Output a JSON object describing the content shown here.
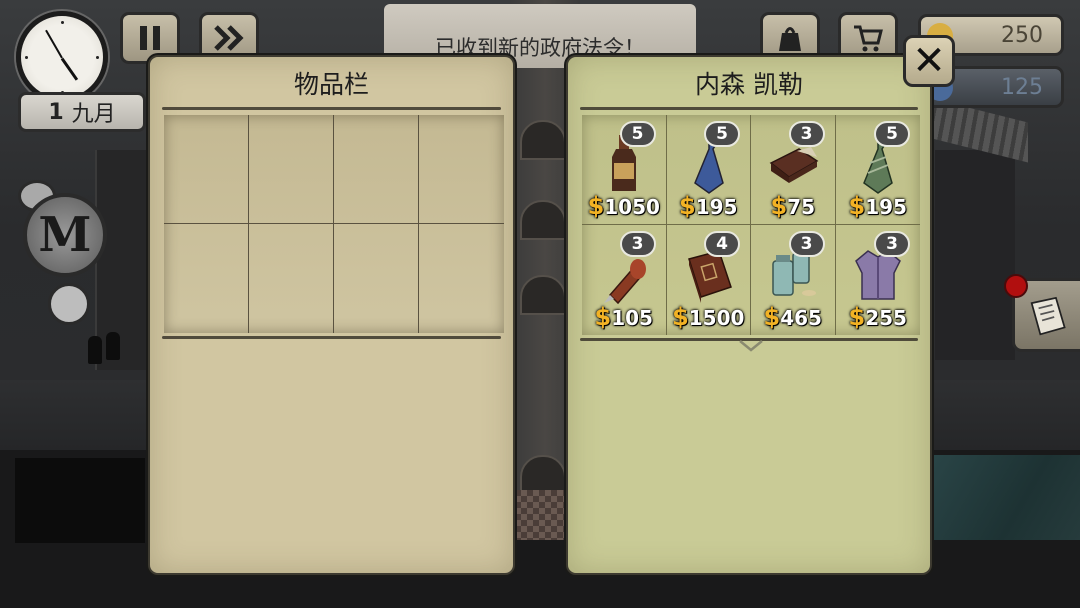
{
  "hud": {
    "date_day": "1",
    "date_month": "九月",
    "money": "250",
    "reputation": "125",
    "notice": "已收到新的政府法令！"
  },
  "inventory": {
    "title": "物品栏"
  },
  "shop": {
    "title": "内森 凯勒",
    "currency_symbol": "$",
    "items": [
      {
        "icon": "bottle-icon",
        "qty": "5",
        "price": "1050"
      },
      {
        "icon": "blue-tie-icon",
        "qty": "5",
        "price": "195"
      },
      {
        "icon": "chocolate-bar-icon",
        "qty": "3",
        "price": "75"
      },
      {
        "icon": "green-tie-icon",
        "qty": "5",
        "price": "195"
      },
      {
        "icon": "fountain-pen-icon",
        "qty": "3",
        "price": "105"
      },
      {
        "icon": "leather-book-icon",
        "qty": "4",
        "price": "1500"
      },
      {
        "icon": "medicine-jars-icon",
        "qty": "3",
        "price": "465"
      },
      {
        "icon": "cardigan-icon",
        "qty": "3",
        "price": "255"
      }
    ]
  },
  "colors": {
    "inventory_panel": "#d1c6a1",
    "shop_panel": "#c9cb96",
    "price_dollar": "#f2b224"
  }
}
